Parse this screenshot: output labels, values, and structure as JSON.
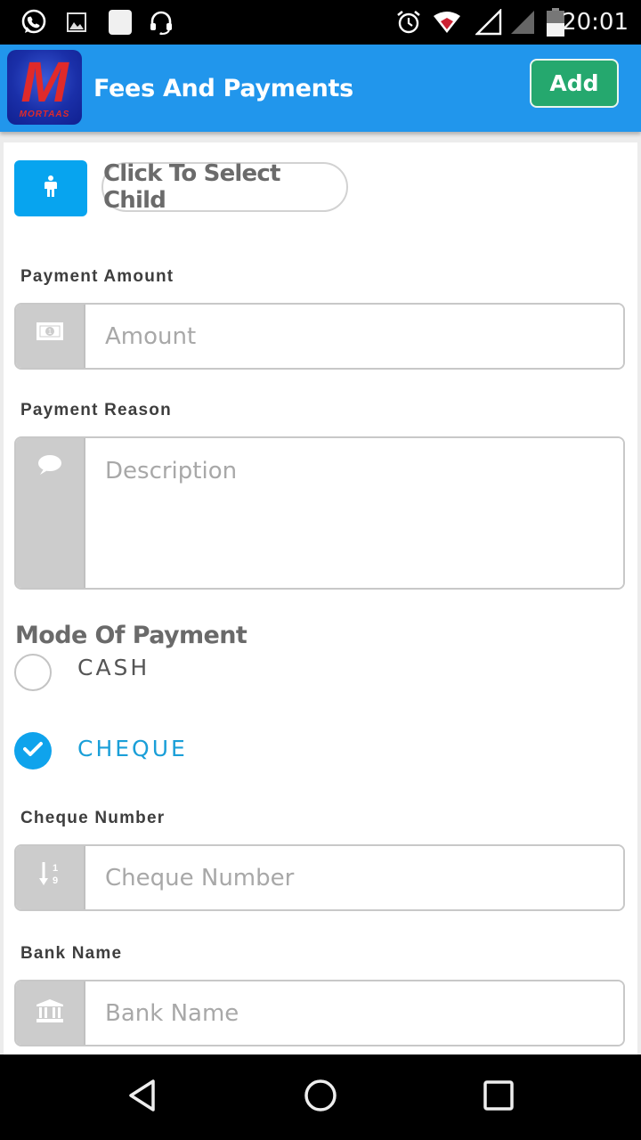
{
  "status_bar": {
    "left_icons": [
      "whatsapp-icon",
      "gallery-icon",
      "notification-icon",
      "headset-icon"
    ],
    "right_icons": [
      "alarm-icon",
      "wifi-icon",
      "signal-icon",
      "signal-bars-icon",
      "battery-icon"
    ],
    "time": "20:01"
  },
  "app_bar": {
    "logo_letter": "M",
    "logo_brand": "MORTAAS",
    "title": "Fees And Payments",
    "add_label": "Add"
  },
  "child_selector": {
    "icon": "person-icon",
    "label": "Click To Select Child"
  },
  "form": {
    "payment_amount": {
      "label": "Payment Amount",
      "icon": "money-icon",
      "placeholder": "Amount",
      "value": ""
    },
    "payment_reason": {
      "label": "Payment Reason",
      "icon": "comment-icon",
      "placeholder": "Description",
      "value": ""
    },
    "mode_of_payment": {
      "title": "Mode Of Payment",
      "options": [
        {
          "label": "CASH",
          "selected": false
        },
        {
          "label": "CHEQUE",
          "selected": true
        }
      ]
    },
    "cheque_number": {
      "label": "Cheque Number",
      "icon": "sort-numeric-icon",
      "placeholder": "Cheque Number",
      "value": ""
    },
    "bank_name": {
      "label": "Bank Name",
      "icon": "bank-icon",
      "placeholder": "Bank Name",
      "value": ""
    }
  },
  "colors": {
    "app_bar": "#2196ec",
    "add_button": "#25a86e",
    "accent": "#0fa3ec",
    "addon_bg": "#cccccc"
  },
  "nav_bar": {
    "buttons": [
      "back-icon",
      "home-icon",
      "recents-icon"
    ]
  }
}
